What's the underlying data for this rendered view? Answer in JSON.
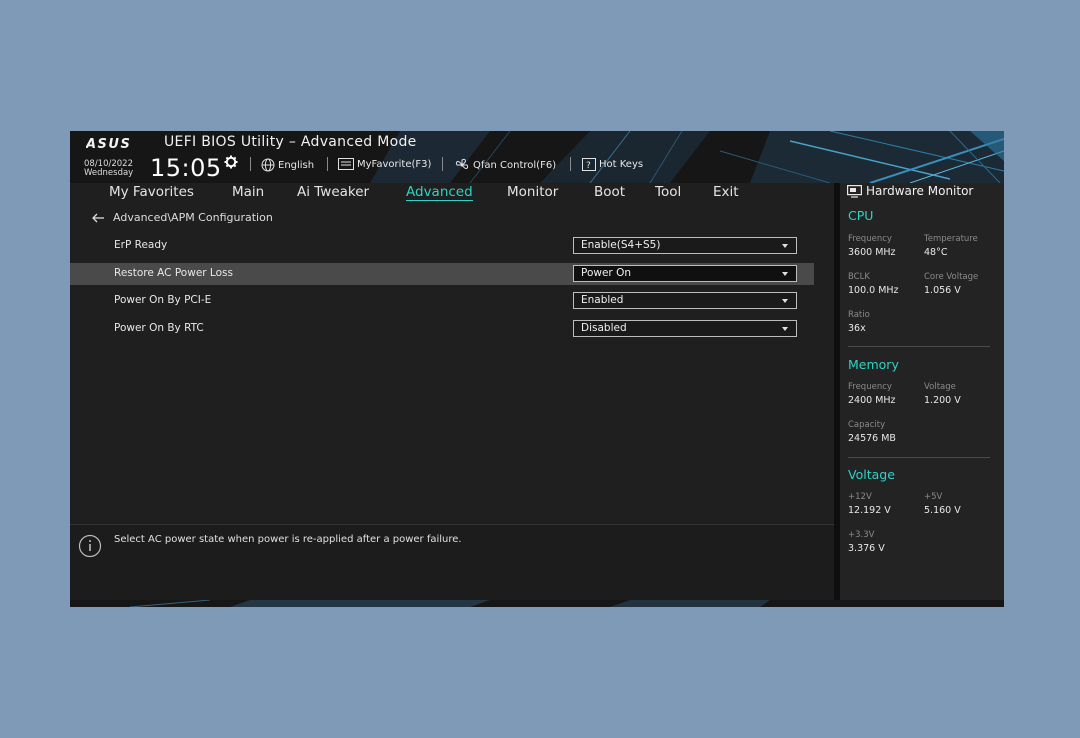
{
  "header": {
    "brand": "ASUS",
    "title": "UEFI BIOS Utility – Advanced Mode",
    "date": "08/10/2022",
    "weekday": "Wednesday",
    "time": "15:05",
    "items": [
      {
        "label": "English",
        "icon": "globe-icon"
      },
      {
        "label": "MyFavorite(F3)",
        "icon": "favorite-icon"
      },
      {
        "label": "Qfan Control(F6)",
        "icon": "fan-icon"
      },
      {
        "label": "Hot Keys",
        "icon": "help-icon"
      }
    ]
  },
  "menu": {
    "items": [
      "My Favorites",
      "Main",
      "Ai Tweaker",
      "Advanced",
      "Monitor",
      "Boot",
      "Tool",
      "Exit"
    ],
    "active": "Advanced"
  },
  "breadcrumb": "Advanced\\APM Configuration",
  "settings": [
    {
      "label": "ErP Ready",
      "value": "Enable(S4+S5)"
    },
    {
      "label": "Restore AC Power Loss",
      "value": "Power On",
      "selected": true
    },
    {
      "label": "Power On By PCI-E",
      "value": "Enabled"
    },
    {
      "label": "Power On By RTC",
      "value": "Disabled"
    }
  ],
  "help": {
    "text": "Select AC power state when power is re-applied after a power failure."
  },
  "hardware_monitor": {
    "title": "Hardware Monitor",
    "cpu": {
      "heading": "CPU",
      "frequency_label": "Frequency",
      "frequency": "3600 MHz",
      "temperature_label": "Temperature",
      "temperature": "48°C",
      "bclk_label": "BCLK",
      "bclk": "100.0 MHz",
      "core_voltage_label": "Core Voltage",
      "core_voltage": "1.056 V",
      "ratio_label": "Ratio",
      "ratio": "36x"
    },
    "memory": {
      "heading": "Memory",
      "frequency_label": "Frequency",
      "frequency": "2400 MHz",
      "voltage_label": "Voltage",
      "voltage": "1.200 V",
      "capacity_label": "Capacity",
      "capacity": "24576 MB"
    },
    "voltage": {
      "heading": "Voltage",
      "v12_label": "+12V",
      "v12": "12.192 V",
      "v5_label": "+5V",
      "v5": "5.160 V",
      "v33_label": "+3.3V",
      "v33": "3.376 V"
    }
  },
  "colors": {
    "accent": "#2fd2c6",
    "page_background": "#7f9ab6",
    "panel_background": "#1f1f1f",
    "selected_row": "#4a4a4a"
  }
}
